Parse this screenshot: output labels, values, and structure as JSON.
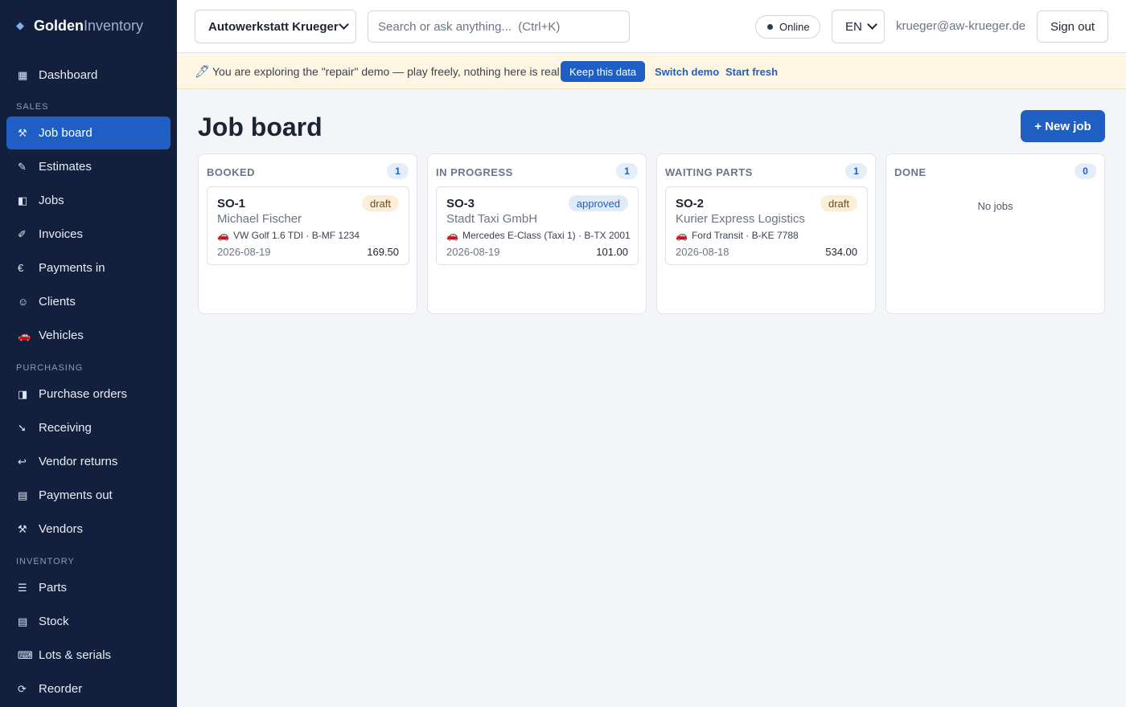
{
  "brand": {
    "name_bold": "Golden",
    "name_light": "Inventory"
  },
  "sidebar": {
    "items": [
      {
        "label": "Dashboard",
        "icon": "▦",
        "icon_name": "dashboard-icon"
      },
      {
        "label": "Job board",
        "icon": "⚒",
        "icon_name": "tools-icon"
      },
      {
        "label": "Estimates",
        "icon": "✎",
        "icon_name": "pencil-icon"
      },
      {
        "label": "Jobs",
        "icon": "◧",
        "icon_name": "jobs-icon"
      },
      {
        "label": "Invoices",
        "icon": "✐",
        "icon_name": "invoice-icon"
      },
      {
        "label": "Payments in",
        "icon": "€",
        "icon_name": "euro-icon"
      },
      {
        "label": "Clients",
        "icon": "☺",
        "icon_name": "client-icon"
      },
      {
        "label": "Vehicles",
        "icon": "🚗",
        "icon_name": "car-icon"
      },
      {
        "label": "Purchase orders",
        "icon": "◨",
        "icon_name": "purchase-order-icon"
      },
      {
        "label": "Receiving",
        "icon": "➘",
        "icon_name": "receiving-icon"
      },
      {
        "label": "Vendor returns",
        "icon": "↩",
        "icon_name": "return-icon"
      },
      {
        "label": "Payments out",
        "icon": "▤",
        "icon_name": "payment-out-icon"
      },
      {
        "label": "Vendors",
        "icon": "⚒",
        "icon_name": "vendor-icon"
      },
      {
        "label": "Parts",
        "icon": "☰",
        "icon_name": "parts-icon"
      },
      {
        "label": "Stock",
        "icon": "▤",
        "icon_name": "stock-icon"
      },
      {
        "label": "Lots & serials",
        "icon": "⌨",
        "icon_name": "tag-icon"
      },
      {
        "label": "Reorder",
        "icon": "⟳",
        "icon_name": "reorder-icon"
      }
    ],
    "active_item": "Job board",
    "sections": [
      "SALES",
      "PURCHASING",
      "INVENTORY"
    ]
  },
  "topbar": {
    "company": "Autowerkstatt Krueger",
    "search_placeholder": "Search or ask anything...  (Ctrl+K)",
    "status": "Online",
    "language": "EN",
    "user_email": "krueger@aw-krueger.de",
    "sign_out": "Sign out"
  },
  "banner": {
    "message": "You are exploring the \"repair\" demo — play freely, nothing here is real.",
    "keep_label": "Keep this data",
    "switch_label": "Switch demo",
    "fresh_label": "Start fresh"
  },
  "main": {
    "title": "Job board",
    "new_job_label": "+ New job",
    "columns": [
      {
        "title": "BOOKED",
        "count": "1",
        "cards": [
          {
            "id": "SO-1",
            "status": "draft",
            "client": "Michael Fischer",
            "vehicle": "VW Golf 1.6 TDI · B-MF 1234",
            "date": "2026-08-19",
            "amount": "169.50"
          }
        ]
      },
      {
        "title": "IN PROGRESS",
        "count": "1",
        "cards": [
          {
            "id": "SO-3",
            "status": "approved",
            "client": "Stadt Taxi GmbH",
            "vehicle": "Mercedes E-Class (Taxi 1) · B-TX 2001",
            "date": "2026-08-19",
            "amount": "101.00"
          }
        ]
      },
      {
        "title": "WAITING PARTS",
        "count": "1",
        "cards": [
          {
            "id": "SO-2",
            "status": "draft",
            "client": "Kurier Express Logistics",
            "vehicle": "Ford Transit · B-KE 7788",
            "date": "2026-08-18",
            "amount": "534.00"
          }
        ]
      },
      {
        "title": "DONE",
        "count": "0",
        "cards": [],
        "empty_text": "No jobs"
      }
    ]
  },
  "colors": {
    "accent": "#1f5fc4",
    "sidebar_bg": "#13203d",
    "banner_bg": "#fdf6e3"
  }
}
